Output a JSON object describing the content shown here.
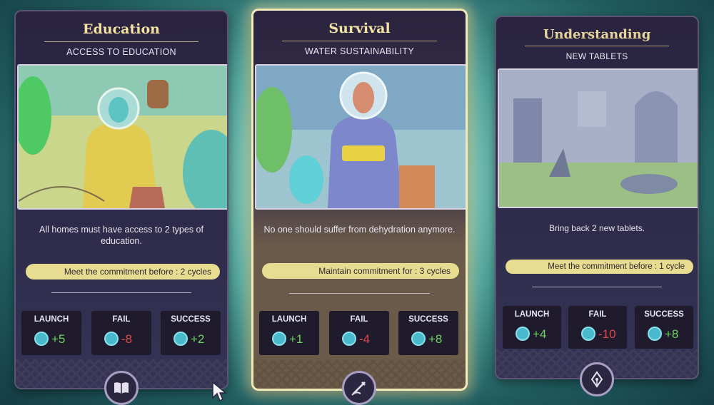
{
  "cards": [
    {
      "title": "Education",
      "subtitle": "ACCESS TO EDUCATION",
      "description": "All homes must have access to 2 types of education.",
      "commitment": "Meet the commitment before : 2 cycles",
      "stats": [
        {
          "label": "LAUNCH",
          "value": "+5"
        },
        {
          "label": "FAIL",
          "value": "-8"
        },
        {
          "label": "SUCCESS",
          "value": "+2"
        }
      ],
      "badge_icon": "open-book-icon"
    },
    {
      "title": "Survival",
      "subtitle": "WATER SUSTAINABILITY",
      "description": "No one should suffer from dehydration anymore.",
      "commitment": "Maintain commitment for : 3 cycles",
      "stats": [
        {
          "label": "LAUNCH",
          "value": "+1"
        },
        {
          "label": "FAIL",
          "value": "-4"
        },
        {
          "label": "SUCCESS",
          "value": "+8"
        }
      ],
      "badge_icon": "hand-writing-icon"
    },
    {
      "title": "Understanding",
      "subtitle": "NEW TABLETS",
      "description": "Bring back 2 new tablets.",
      "commitment": "Meet the commitment before : 1 cycle",
      "stats": [
        {
          "label": "LAUNCH",
          "value": "+4"
        },
        {
          "label": "FAIL",
          "value": "-10"
        },
        {
          "label": "SUCCESS",
          "value": "+8"
        }
      ],
      "badge_icon": "pen-nib-icon"
    }
  ],
  "colors": {
    "title": "#f4e2a0",
    "pill": "#e8dc90",
    "positive": "#6fd35f",
    "negative": "#e0484a",
    "highlight_border": "#f2eab8"
  }
}
